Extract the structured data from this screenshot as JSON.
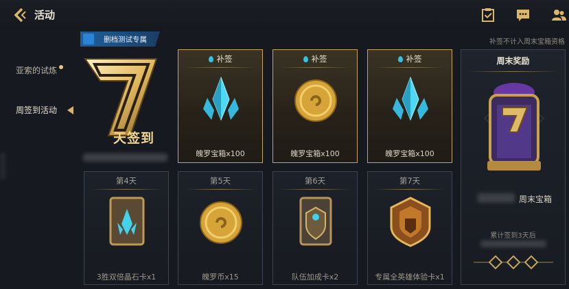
{
  "header": {
    "title": "活动"
  },
  "sidebar": {
    "items": [
      {
        "label": "亚索的试炼"
      },
      {
        "label": "周签到活动"
      }
    ]
  },
  "banner": {
    "ribbon": "删档测试专属",
    "logo_text": "天签到",
    "note": "补签不计入周末宝箱资格"
  },
  "makeup_cards": [
    {
      "head": "补签",
      "label": "魄罗宝箱x100",
      "icon": "crystal-icon"
    },
    {
      "head": "补签",
      "label": "魄罗宝箱x100",
      "icon": "gold-coin-icon"
    },
    {
      "head": "补签",
      "label": "魄罗宝箱x100",
      "icon": "crystal-icon"
    }
  ],
  "day_cards": [
    {
      "head": "第4天",
      "label": "3胜双倍晶石卡x1",
      "icon": "crystal-card-icon"
    },
    {
      "head": "第5天",
      "label": "魄罗币x15",
      "icon": "gold-coin-icon"
    },
    {
      "head": "第6天",
      "label": "队伍加成卡x2",
      "icon": "shield-card-icon"
    },
    {
      "head": "第7天",
      "label": "专属全英雄体验卡x1",
      "icon": "champion-card-icon"
    }
  ],
  "weekly": {
    "head": "周末奖励",
    "item_label": "周末宝箱",
    "requirement": "累计签到3天后"
  },
  "colors": {
    "gold": "#c6a65c",
    "accent_blue": "#1f5f99",
    "crystal": "#39c1d9"
  }
}
